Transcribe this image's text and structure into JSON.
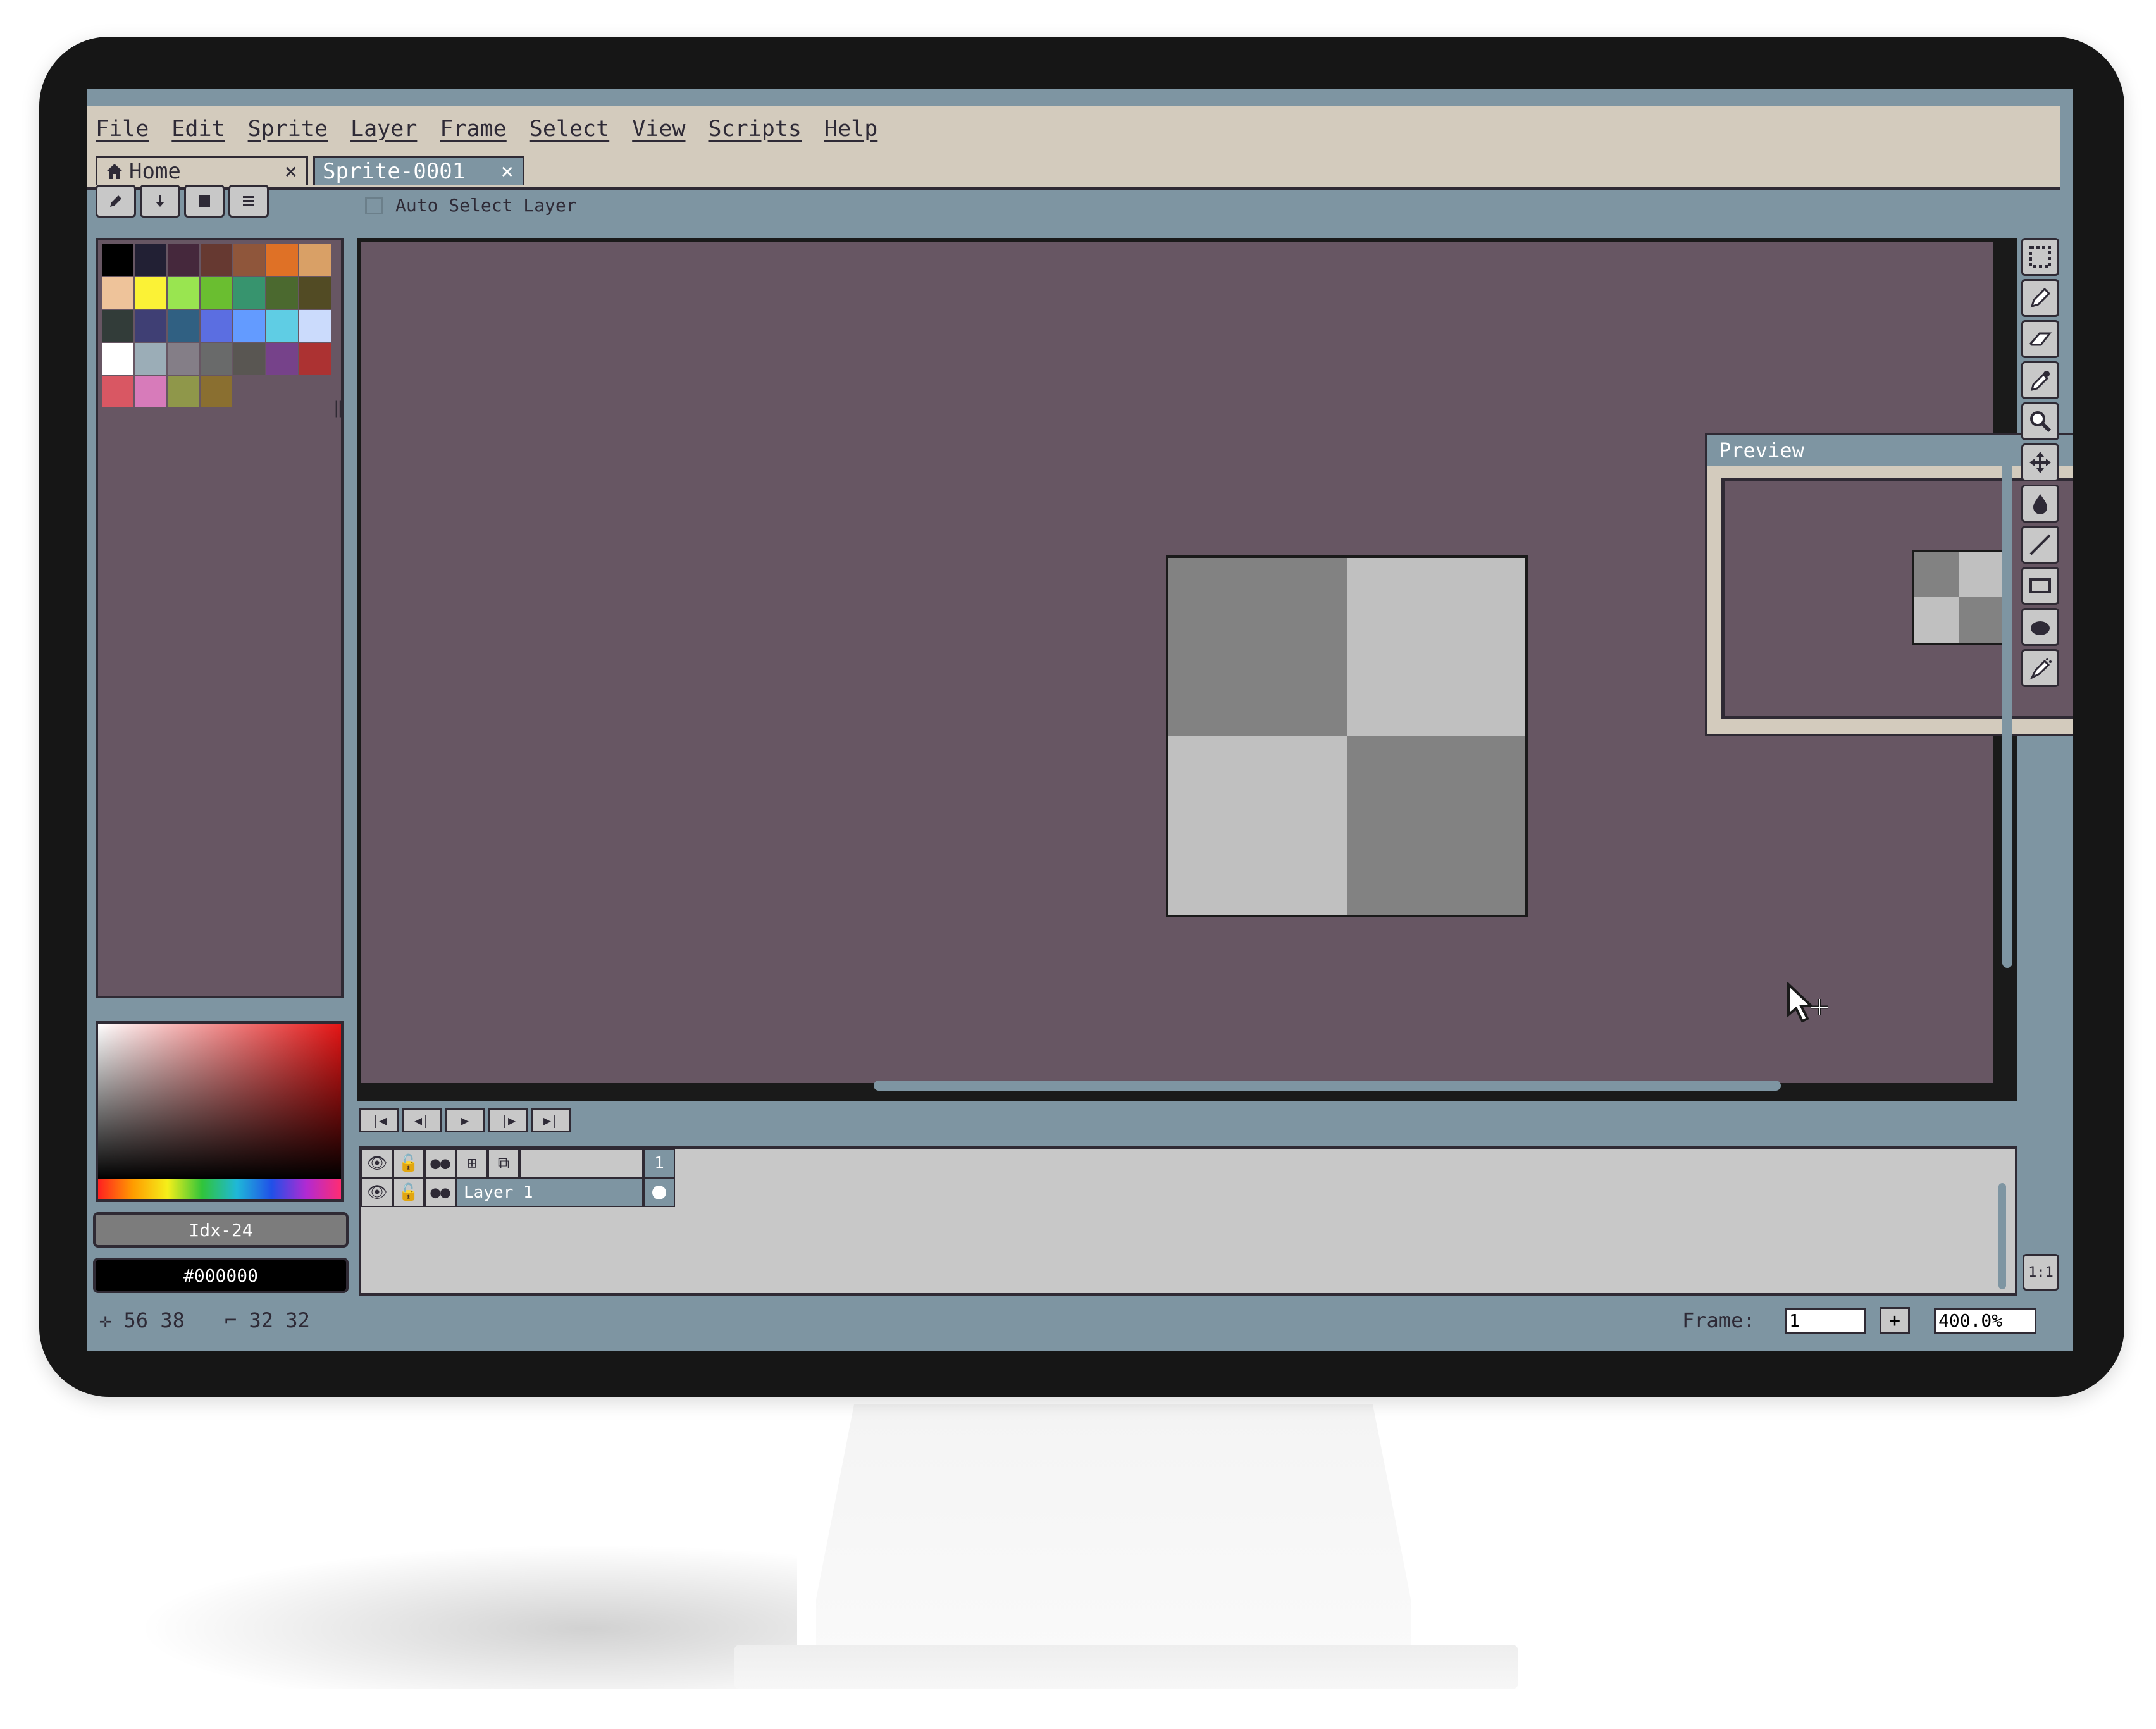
{
  "menu": [
    "File",
    "Edit",
    "Sprite",
    "Layer",
    "Frame",
    "Select",
    "View",
    "Scripts",
    "Help"
  ],
  "tabs": {
    "home": {
      "label": "Home",
      "icon": "home-icon",
      "close": "×"
    },
    "sprite": {
      "label": "Sprite-0001",
      "close": "×"
    }
  },
  "toolbar": {
    "buttons": [
      "pencil-icon",
      "download-icon",
      "save-icon",
      "menu-icon"
    ],
    "auto_select_label": "Auto Select Layer",
    "auto_select_checked": false
  },
  "palette": {
    "colors": [
      "#000000",
      "#222034",
      "#45283c",
      "#663931",
      "#8f563b",
      "#df7126",
      "#d9a066",
      "#eec39a",
      "#fbf236",
      "#99e550",
      "#6abe30",
      "#37946e",
      "#4b692f",
      "#524b24",
      "#323c39",
      "#3f3f74",
      "#306082",
      "#5b6ee1",
      "#639bff",
      "#5fcde4",
      "#cbdbfc",
      "#ffffff",
      "#9badb7",
      "#847e87",
      "#696a6a",
      "#595652",
      "#76428a",
      "#ac3232",
      "#d95763",
      "#d77bba",
      "#8f974a",
      "#8a6f30"
    ],
    "selected_index": 24
  },
  "color_picker": {
    "idx_label": "Idx-24",
    "hex_label": "#000000"
  },
  "preview": {
    "title": "Preview"
  },
  "sprite_cells": [
    "#828282",
    "#c0c0c0",
    "#c0c0c0",
    "#828282"
  ],
  "tools": [
    "marquee-icon",
    "pencil-icon",
    "eraser-icon",
    "eyedropper-icon",
    "zoom-icon",
    "move-icon",
    "fill-icon",
    "line-icon",
    "rectangle-icon",
    "ellipse-icon",
    "spray-icon"
  ],
  "timeline": {
    "frame_number": "1",
    "layer_name": "Layer 1"
  },
  "status": {
    "cursor_pos": "56 38",
    "sprite_size": "32 32",
    "frame_label": "Frame:",
    "frame_value": "1",
    "add_frame": "+",
    "zoom_value": "400.0%",
    "zoom_button": "1:1"
  },
  "colors": {
    "canvas_bg": "#675663",
    "ui_bg": "#7e95a2",
    "menu_bg": "#d3cbbd"
  }
}
